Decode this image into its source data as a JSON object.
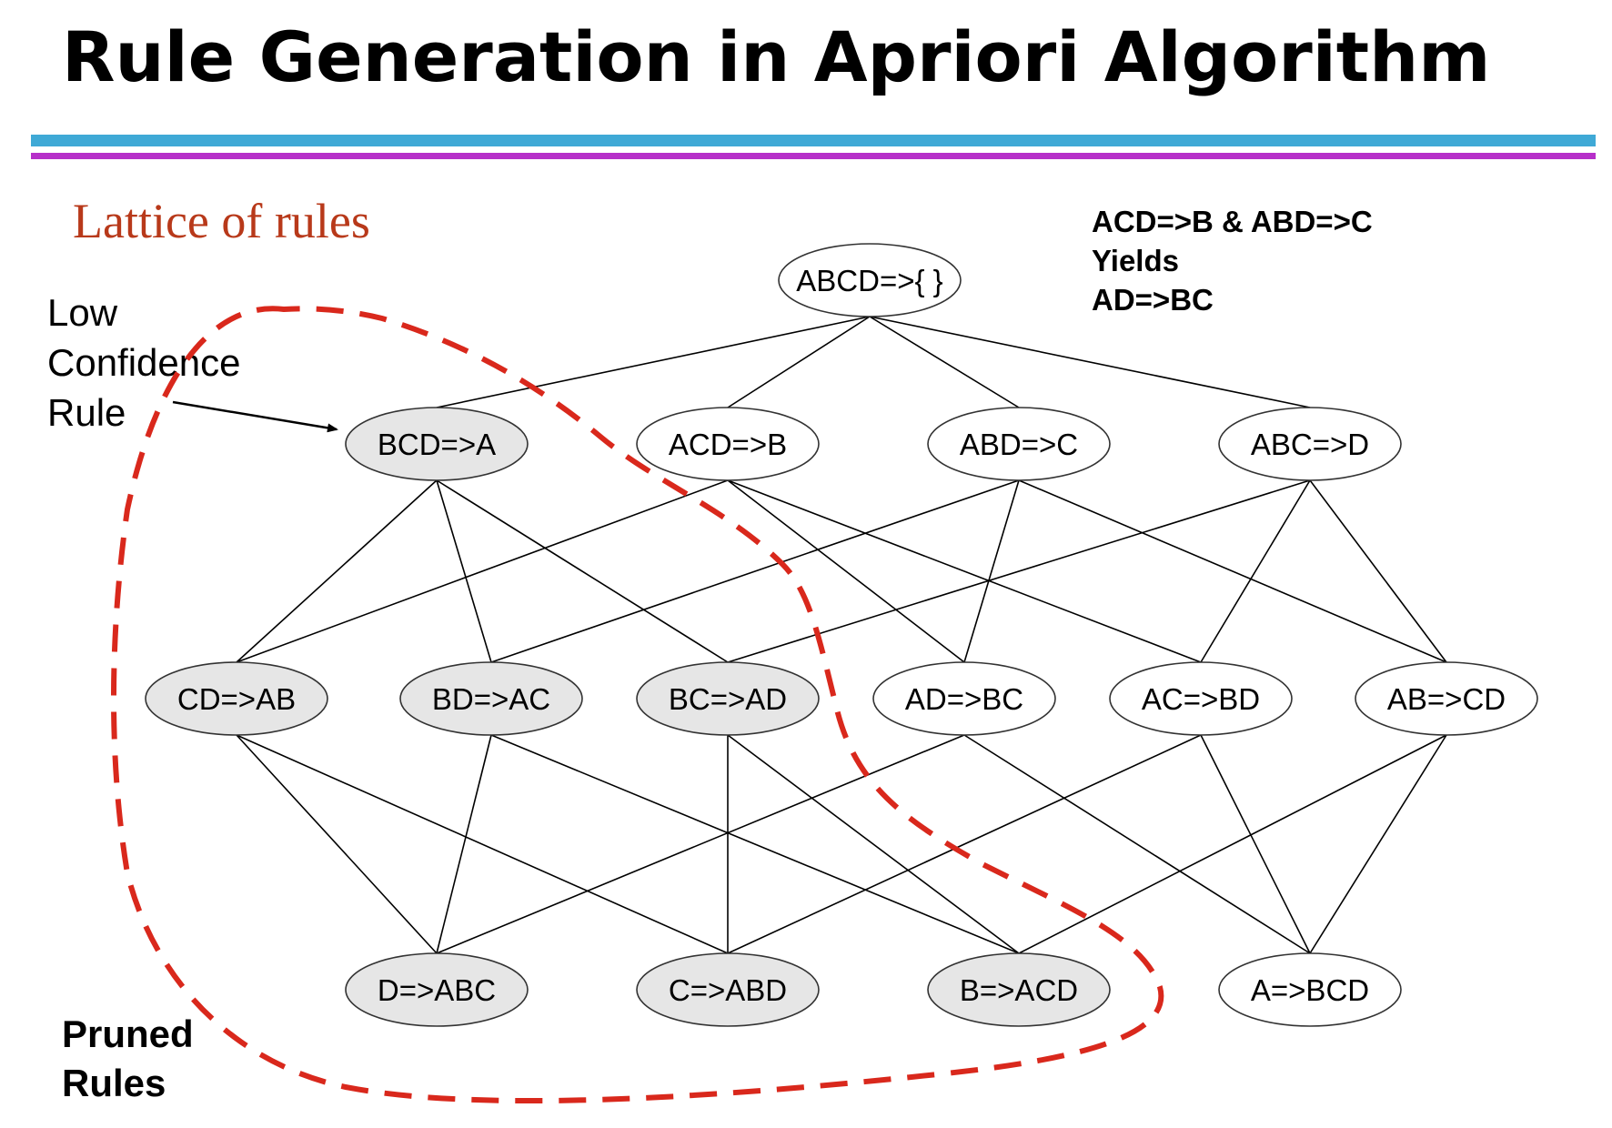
{
  "title": "Rule Generation in Apriori Algorithm",
  "subtitle": "Lattice of rules",
  "note": [
    "ACD=>B & ABD=>C",
    "Yields",
    "AD=>BC"
  ],
  "annotation_low_confidence": [
    "Low",
    "Confidence",
    "Rule"
  ],
  "annotation_pruned": [
    "Pruned",
    "Rules"
  ],
  "colors": {
    "bar_top": "#3fa9d6",
    "bar_bottom": "#b62fc9",
    "subtitle": "#b8391a",
    "pruned_fill": "#e6e6e6",
    "normal_fill": "#ffffff",
    "prune_boundary": "#d9281c"
  },
  "nodes": [
    {
      "id": "ABCD",
      "label": "ABCD=>{ }",
      "pruned": false
    },
    {
      "id": "BCD",
      "label": "BCD=>A",
      "pruned": true
    },
    {
      "id": "ACD",
      "label": "ACD=>B",
      "pruned": false
    },
    {
      "id": "ABD",
      "label": "ABD=>C",
      "pruned": false
    },
    {
      "id": "ABC",
      "label": "ABC=>D",
      "pruned": false
    },
    {
      "id": "CD",
      "label": "CD=>AB",
      "pruned": true
    },
    {
      "id": "BD",
      "label": "BD=>AC",
      "pruned": true
    },
    {
      "id": "BC",
      "label": "BC=>AD",
      "pruned": true
    },
    {
      "id": "AD",
      "label": "AD=>BC",
      "pruned": false
    },
    {
      "id": "AC",
      "label": "AC=>BD",
      "pruned": false
    },
    {
      "id": "AB",
      "label": "AB=>CD",
      "pruned": false
    },
    {
      "id": "D",
      "label": "D=>ABC",
      "pruned": true
    },
    {
      "id": "C",
      "label": "C=>ABD",
      "pruned": true
    },
    {
      "id": "B",
      "label": "B=>ACD",
      "pruned": true
    },
    {
      "id": "A",
      "label": "A=>BCD",
      "pruned": false
    }
  ],
  "edges": [
    [
      "ABCD",
      "BCD"
    ],
    [
      "ABCD",
      "ACD"
    ],
    [
      "ABCD",
      "ABD"
    ],
    [
      "ABCD",
      "ABC"
    ],
    [
      "BCD",
      "CD"
    ],
    [
      "BCD",
      "BD"
    ],
    [
      "BCD",
      "BC"
    ],
    [
      "ACD",
      "CD"
    ],
    [
      "ACD",
      "AD"
    ],
    [
      "ACD",
      "AC"
    ],
    [
      "ABD",
      "BD"
    ],
    [
      "ABD",
      "AD"
    ],
    [
      "ABD",
      "AB"
    ],
    [
      "ABC",
      "BC"
    ],
    [
      "ABC",
      "AC"
    ],
    [
      "ABC",
      "AB"
    ],
    [
      "CD",
      "D"
    ],
    [
      "CD",
      "C"
    ],
    [
      "BD",
      "D"
    ],
    [
      "BD",
      "B"
    ],
    [
      "BC",
      "C"
    ],
    [
      "BC",
      "B"
    ],
    [
      "AD",
      "D"
    ],
    [
      "AD",
      "A"
    ],
    [
      "AC",
      "C"
    ],
    [
      "AC",
      "A"
    ],
    [
      "AB",
      "B"
    ],
    [
      "AB",
      "A"
    ]
  ]
}
